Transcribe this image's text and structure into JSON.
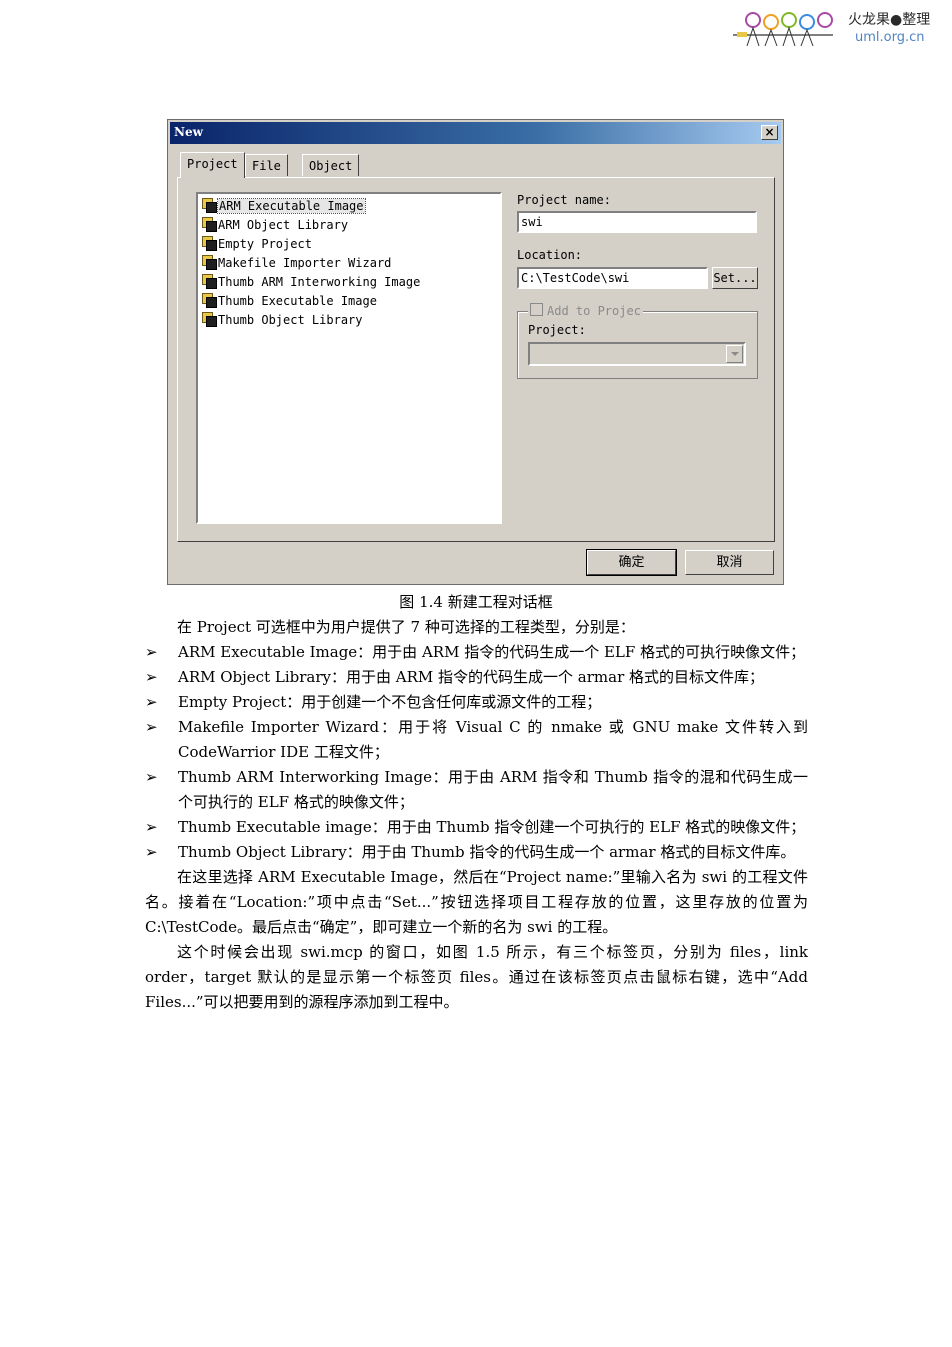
{
  "header": {
    "logo_text": "火龙果●整理",
    "logo_url": "uml.org.cn"
  },
  "dialog": {
    "title": "New",
    "close_label": "×",
    "tabs": [
      "Project",
      "File",
      "Object"
    ],
    "project_types": [
      "ARM Executable Image",
      "ARM Object Library",
      "Empty Project",
      "Makefile Importer Wizard",
      "Thumb ARM Interworking Image",
      "Thumb Executable Image",
      "Thumb Object Library"
    ],
    "project_name_label": "Project name:",
    "project_name_value": "swi",
    "location_label": "Location:",
    "location_value": "C:\\TestCode\\swi",
    "set_button": "Set...",
    "add_to_project_label": "Add to Projec",
    "project_label": "Project:",
    "ok_button": "确定",
    "cancel_button": "取消"
  },
  "document": {
    "caption": "图 1.4  新建工程对话框",
    "intro": "在 Project 可选框中为用户提供了 7 种可选择的工程类型，分别是：",
    "bullet_marker": "➢",
    "bullets": [
      "ARM Executable Image：用于由 ARM 指令的代码生成一个 ELF 格式的可执行映像文件；",
      "ARM Object Library：用于由 ARM 指令的代码生成一个 armar 格式的目标文件库；",
      "Empty Project：用于创建一个不包含任何库或源文件的工程；",
      "Makefile Importer Wizard：用于将 Visual C 的 nmake 或 GNU make 文件转入到 CodeWarrior IDE 工程文件；",
      "Thumb ARM Interworking Image：用于由 ARM 指令和 Thumb 指令的混和代码生成一个可执行的 ELF 格式的映像文件；",
      "Thumb Executable image：用于由 Thumb 指令创建一个可执行的 ELF 格式的映像文件；",
      "Thumb Object Library：用于由 Thumb 指令的代码生成一个 armar 格式的目标文件库。"
    ],
    "para1": "在这里选择 ARM Executable Image，然后在“Project name:”里输入名为 swi 的工程文件名。接着在“Location:”项中点击“Set...”按钮选择项目工程存放的位置，这里存放的位置为 C:\\TestCode。最后点击“确定”，即可建立一个新的名为 swi 的工程。",
    "para2": "这个时候会出现 swi.mcp 的窗口，如图 1.5 所示，有三个标签页，分别为 files，link order，target 默认的是显示第一个标签页 files。通过在该标签页点击鼠标右键，选中“Add Files...”可以把要用到的源程序添加到工程中。"
  }
}
